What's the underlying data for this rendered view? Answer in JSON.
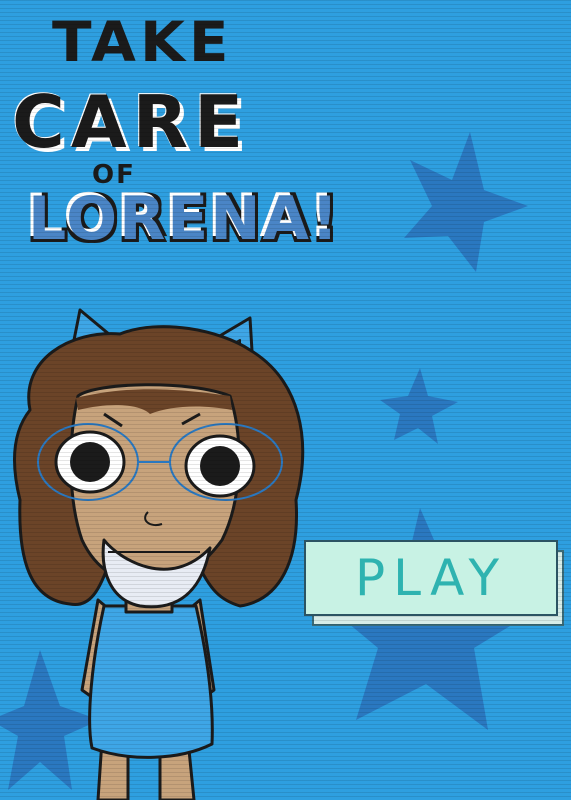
{
  "title": {
    "line1": "TAKE",
    "line2": "CARE",
    "line3": "OF",
    "line4": "LORENA!"
  },
  "play_button": {
    "label": "PLAY"
  },
  "colors": {
    "background": "#2e9fe0",
    "star": "#2a78c0",
    "dress": "#3ea6e6",
    "skin": "#c7a37c",
    "hair": "#6b4428",
    "button_fill": "#c8f2e4",
    "button_text": "#2eb3b0"
  },
  "icons": [
    "star-icon",
    "character-lorena"
  ]
}
